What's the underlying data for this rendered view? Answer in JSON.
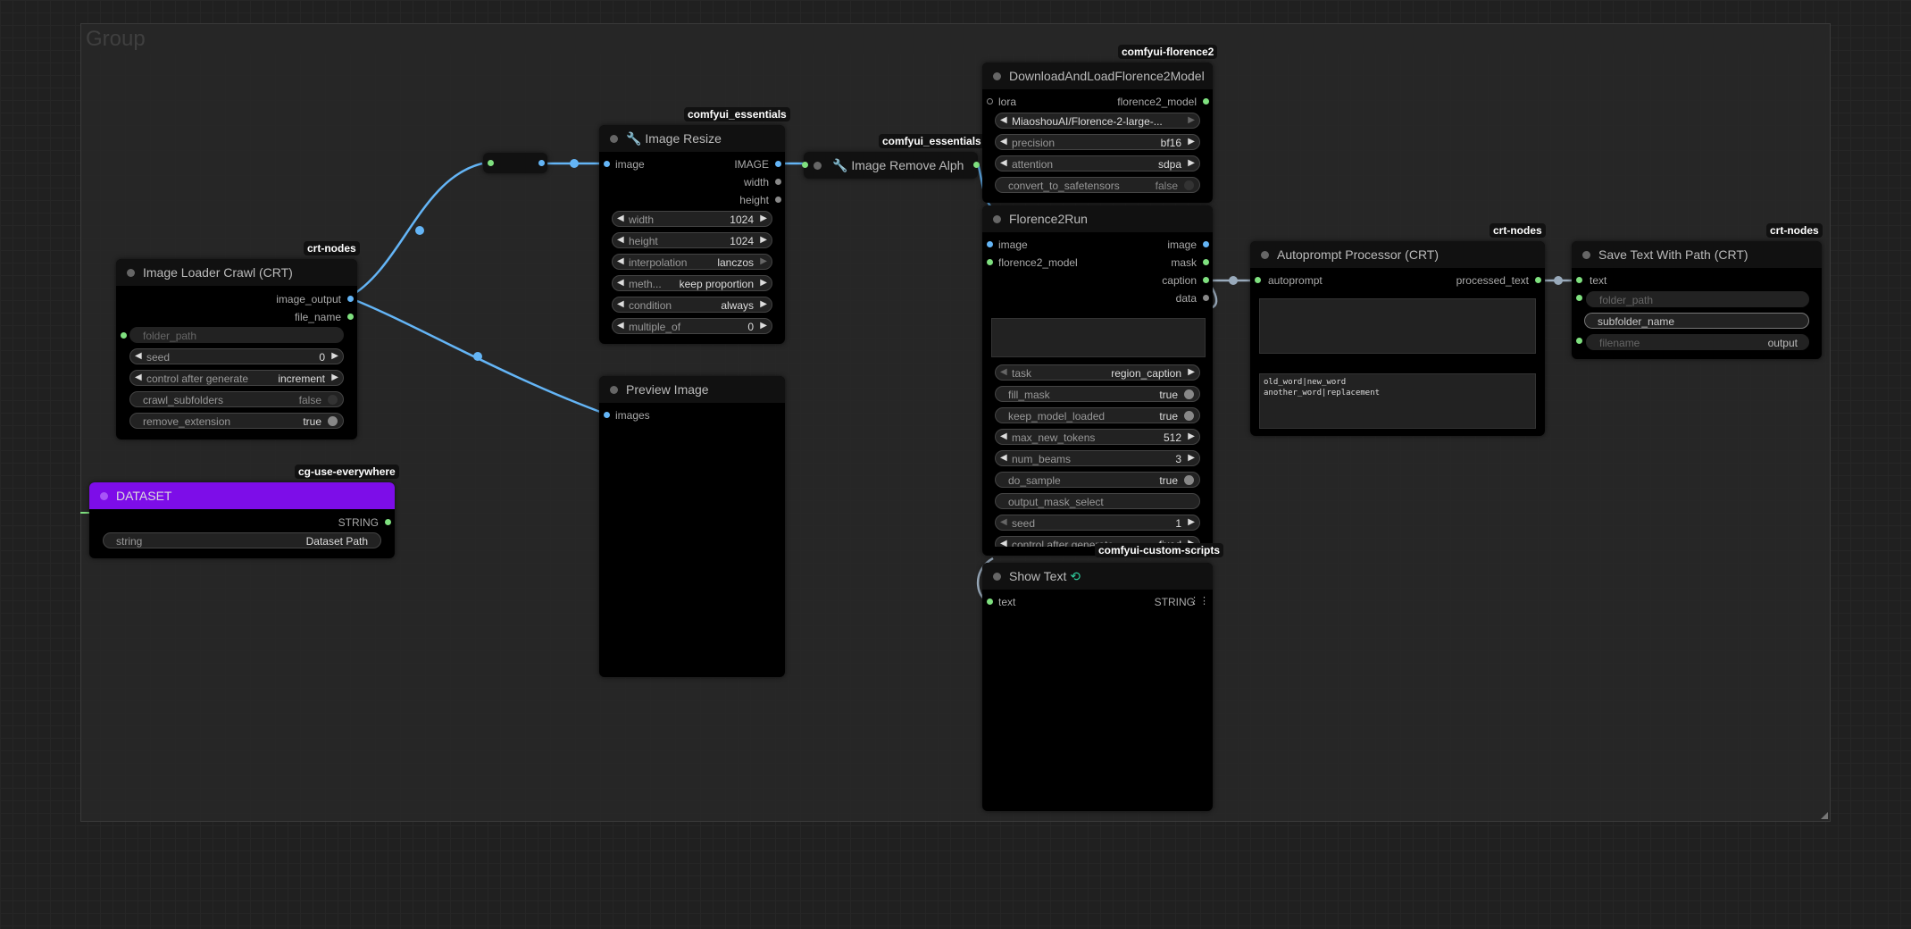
{
  "group": {
    "title": "Group"
  },
  "badges": {
    "florence2": "comfyui-florence2",
    "essentials1": "comfyui_essentials",
    "essentials2": "comfyui_essentials",
    "crt1": "crt-nodes",
    "crt2": "crt-nodes",
    "crt3": "crt-nodes",
    "cg": "cg-use-everywhere",
    "custom_scripts": "comfyui-custom-scripts"
  },
  "image_loader": {
    "title": "Image Loader Crawl (CRT)",
    "outputs": [
      "image_output",
      "file_name"
    ],
    "folder_path": "folder_path",
    "seed": {
      "label": "seed",
      "value": "0"
    },
    "control": {
      "label": "control after generate",
      "value": "increment"
    },
    "crawl_subfolders": {
      "label": "crawl_subfolders",
      "value": "false"
    },
    "remove_extension": {
      "label": "remove_extension",
      "value": "true"
    }
  },
  "dataset": {
    "title": "DATASET",
    "output": "STRING",
    "string": {
      "label": "string",
      "value": "Dataset Path"
    },
    "color": "#7d0de8"
  },
  "image_resize": {
    "title": "Image Resize",
    "input": "image",
    "outputs": [
      "IMAGE",
      "width",
      "height"
    ],
    "width": {
      "label": "width",
      "value": "1024"
    },
    "height": {
      "label": "height",
      "value": "1024"
    },
    "interpolation": {
      "label": "interpolation",
      "value": "lanczos"
    },
    "method": {
      "label": "meth...",
      "value": "keep proportion"
    },
    "condition": {
      "label": "condition",
      "value": "always"
    },
    "multiple_of": {
      "label": "multiple_of",
      "value": "0"
    }
  },
  "image_remove_alpha": {
    "title": "Image Remove Alph"
  },
  "preview": {
    "title": "Preview Image",
    "input": "images"
  },
  "download_florence": {
    "title": "DownloadAndLoadFlorence2Model",
    "input": "lora",
    "output": "florence2_model",
    "model": {
      "value": "MiaoshouAI/Florence-2-large-..."
    },
    "precision": {
      "label": "precision",
      "value": "bf16"
    },
    "attention": {
      "label": "attention",
      "value": "sdpa"
    },
    "convert": {
      "label": "convert_to_safetensors",
      "value": "false"
    }
  },
  "florence_run": {
    "title": "Florence2Run",
    "inputs": [
      "image",
      "florence2_model"
    ],
    "outputs": [
      "image",
      "mask",
      "caption",
      "data"
    ],
    "task": {
      "label": "task",
      "value": "region_caption"
    },
    "fill_mask": {
      "label": "fill_mask",
      "value": "true"
    },
    "keep_model_loaded": {
      "label": "keep_model_loaded",
      "value": "true"
    },
    "max_new_tokens": {
      "label": "max_new_tokens",
      "value": "512"
    },
    "num_beams": {
      "label": "num_beams",
      "value": "3"
    },
    "do_sample": {
      "label": "do_sample",
      "value": "true"
    },
    "output_mask_select": {
      "label": "output_mask_select"
    },
    "seed": {
      "label": "seed",
      "value": "1"
    },
    "control": {
      "label": "control after generate",
      "value": "fixed"
    }
  },
  "show_text": {
    "title": "Show Text",
    "input": "text",
    "output": "STRING"
  },
  "autoprompt": {
    "title": "Autoprompt Processor (CRT)",
    "input": "autoprompt",
    "output": "processed_text",
    "replacements": "old_word|new_word\nanother_word|replacement"
  },
  "save_text": {
    "title": "Save Text With Path (CRT)",
    "input": "text",
    "folder_path": "folder_path",
    "subfolder_name": "subfolder_name",
    "filename": {
      "label": "filename",
      "value": "output"
    }
  },
  "colors": {
    "image_link": "#64b5f6",
    "string_link": "#7fe07f",
    "canvas": "#202020"
  }
}
